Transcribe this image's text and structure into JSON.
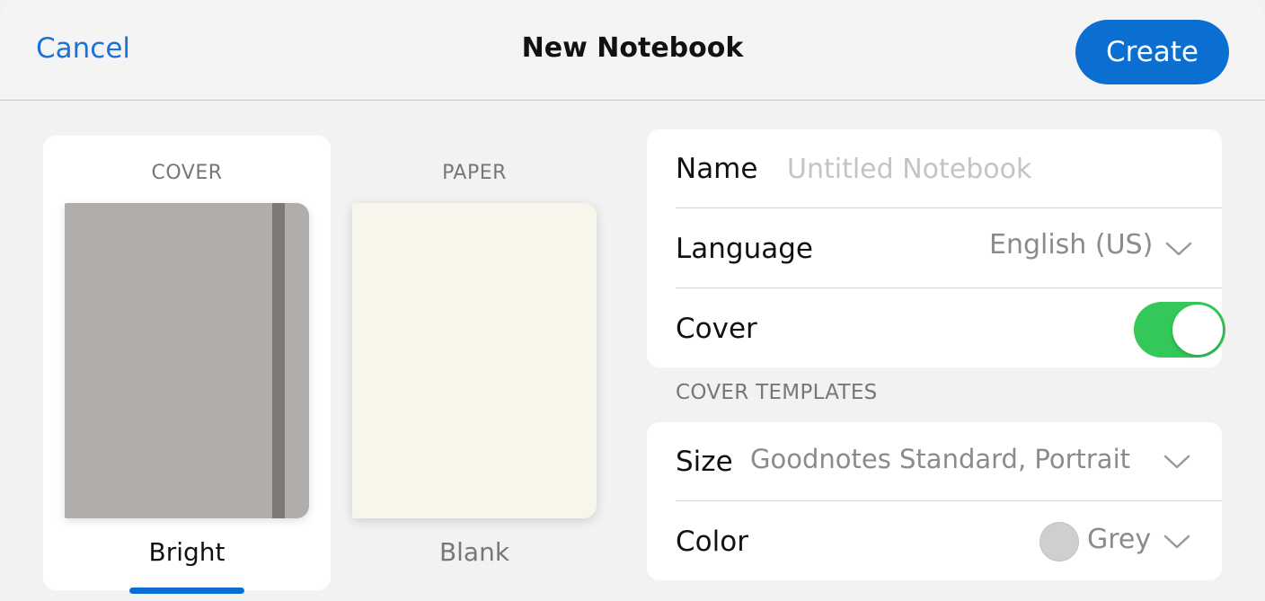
{
  "header": {
    "cancel_label": "Cancel",
    "title": "New Notebook",
    "create_label": "Create"
  },
  "previews": {
    "cover": {
      "heading": "COVER",
      "name": "Bright",
      "color": "#b1adab",
      "band_color": "#7e7876",
      "selected": true
    },
    "paper": {
      "heading": "PAPER",
      "name": "Blank",
      "color": "#f8f6ea",
      "selected": false
    }
  },
  "form": {
    "name": {
      "label": "Name",
      "value": "",
      "placeholder": "Untitled Notebook"
    },
    "language": {
      "label": "Language",
      "value": "English (US)",
      "icon": "chevron-down-icon"
    },
    "cover": {
      "label": "Cover",
      "enabled": true,
      "toggle_color": "#34c759"
    },
    "cover_templates_header": "COVER TEMPLATES",
    "size": {
      "label": "Size",
      "value": "Goodnotes Standard, Portrait",
      "icon": "chevron-down-icon"
    },
    "color": {
      "label": "Color",
      "value": "Grey",
      "swatch_color": "#cfcfcf",
      "icon": "chevron-down-icon"
    }
  },
  "colors": {
    "accent": "#0b6fd1",
    "link": "#1a73d9"
  }
}
